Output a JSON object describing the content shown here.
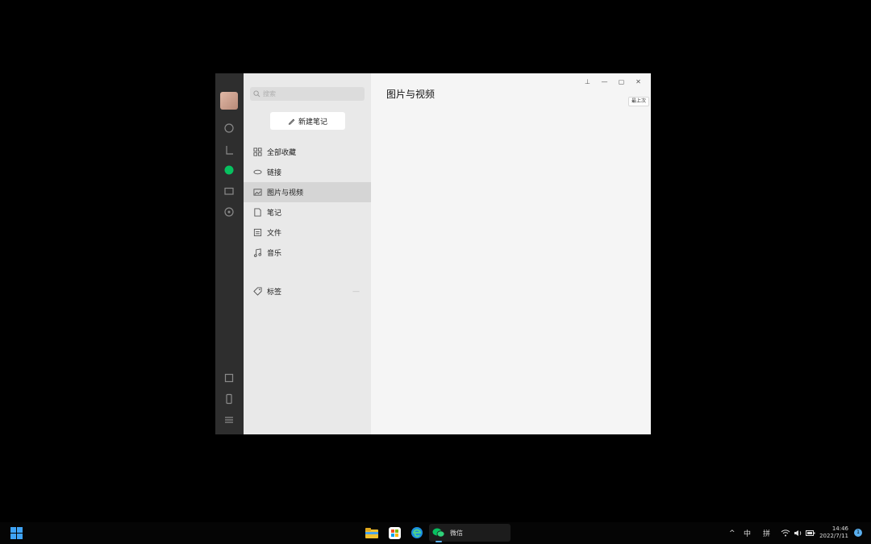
{
  "sidebar": {
    "search_placeholder": "搜索",
    "new_note_label": "新建笔记",
    "items": [
      {
        "label": "全部收藏",
        "icon": "grid-icon"
      },
      {
        "label": "链接",
        "icon": "link-icon"
      },
      {
        "label": "图片与视频",
        "icon": "image-icon"
      },
      {
        "label": "笔记",
        "icon": "note-icon"
      },
      {
        "label": "文件",
        "icon": "file-icon"
      },
      {
        "label": "音乐",
        "icon": "music-icon"
      }
    ],
    "tags_label": "标签",
    "tags_more": "—",
    "footer_line1": "",
    "footer_line2": ""
  },
  "main": {
    "title": "图片与视频",
    "upload_label": "最上次"
  },
  "window_controls": {
    "pin": "⊥",
    "minimize": "—",
    "maximize": "▢",
    "close": "✕"
  },
  "taskbar": {
    "wechat_label": "微信",
    "tray_chevron": "^",
    "ime_lang": "中",
    "ime_mode": "拼",
    "time": "14:46",
    "date": "2022/7/11",
    "notification_count": "1"
  },
  "colors": {
    "accent_green": "#07c160",
    "rail_bg": "#2e2e2e",
    "sidebar_bg": "#e9e9e9",
    "main_bg": "#f5f5f5",
    "taskbar_bg": "#050505",
    "windows_blue": "#3fa3f5"
  }
}
